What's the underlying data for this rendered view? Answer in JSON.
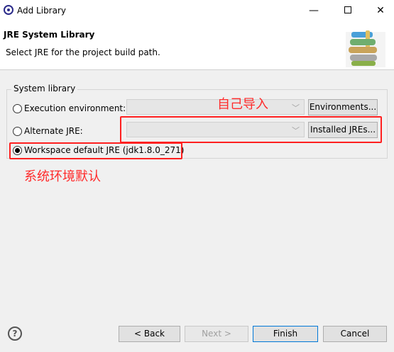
{
  "window": {
    "title": "Add Library",
    "minimize_glyph": "—",
    "close_glyph": "✕"
  },
  "banner": {
    "title": "JRE System Library",
    "description": "Select JRE for the project build path."
  },
  "group": {
    "label": "System library",
    "options": [
      {
        "label": "Execution environment:",
        "checked": false
      },
      {
        "label": "Alternate JRE:",
        "checked": false
      },
      {
        "label": "Workspace default JRE (jdk1.8.0_271)",
        "checked": true
      }
    ],
    "environments_button": "Environments...",
    "installed_jres_button": "Installed JREs..."
  },
  "annotations": {
    "import_note": "自己导入",
    "default_note": "系统环境默认",
    "color": "#ff2020"
  },
  "footer": {
    "help_glyph": "?",
    "back_button": "< Back",
    "next_button": "Next >",
    "finish_button": "Finish",
    "cancel_button": "Cancel"
  }
}
